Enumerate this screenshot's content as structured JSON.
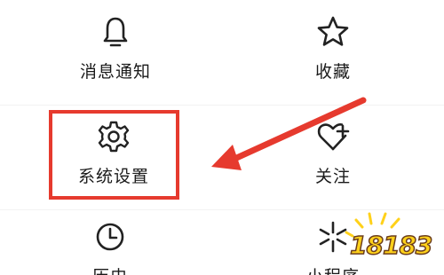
{
  "menu": {
    "items": [
      {
        "label": "消息通知",
        "icon": "bell-icon"
      },
      {
        "label": "收藏",
        "icon": "star-icon"
      },
      {
        "label": "系统设置",
        "icon": "gear-icon"
      },
      {
        "label": "关注",
        "icon": "heart-plus-icon"
      },
      {
        "label": "历史",
        "icon": "clock-icon"
      },
      {
        "label": "小程序",
        "icon": "sparkle-icon"
      }
    ]
  },
  "annotation": {
    "highlight_color": "#e63a2e",
    "arrow_color": "#e63a2e",
    "highlighted_item": "系统设置"
  },
  "watermark": {
    "text": "18183",
    "color": "#ffd11a"
  }
}
